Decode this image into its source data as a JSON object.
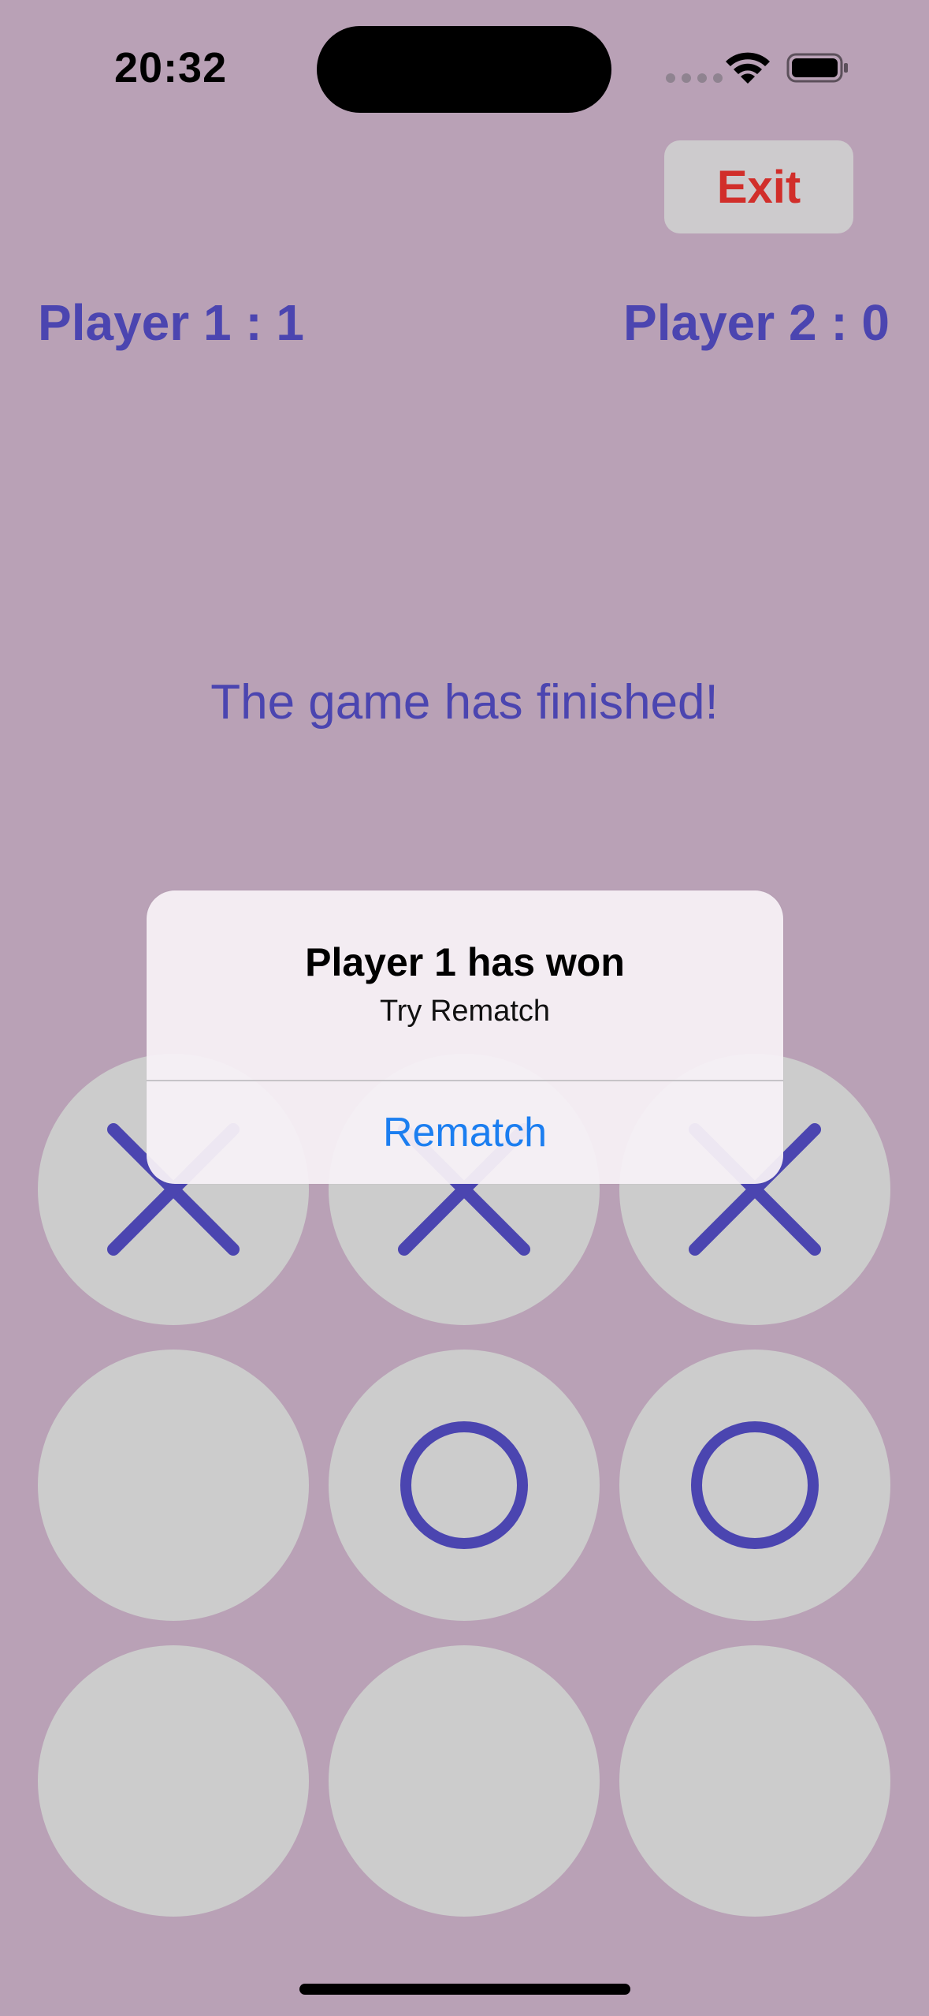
{
  "status_bar": {
    "time": "20:32"
  },
  "header": {
    "exit_label": "Exit"
  },
  "scores": {
    "player1": "Player 1 : 1",
    "player2": "Player 2 : 0"
  },
  "game": {
    "message": "The game has finished!",
    "board": [
      "X",
      "X",
      "X",
      "",
      "O",
      "O",
      "",
      "",
      ""
    ],
    "mark_color": "#4b45b0",
    "cell_color": "#cccccc",
    "background_color": "#b9a1b6"
  },
  "alert": {
    "title": "Player 1 has won",
    "message": "Try Rematch",
    "button_label": "Rematch"
  }
}
